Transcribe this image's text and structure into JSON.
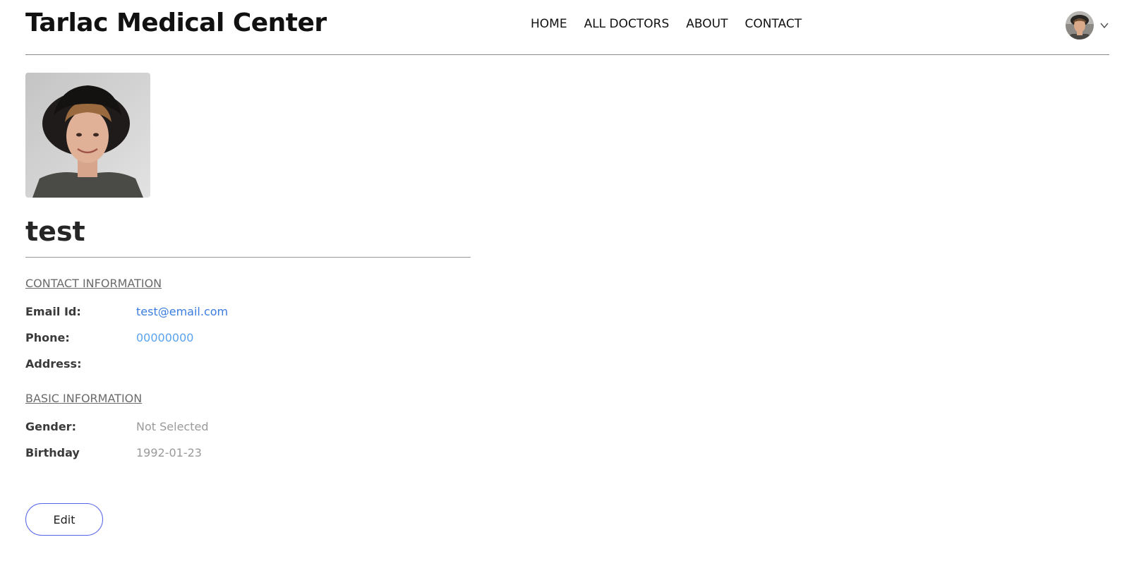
{
  "header": {
    "brand": "Tarlac Medical Center",
    "nav": [
      "HOME",
      "ALL DOCTORS",
      "ABOUT",
      "CONTACT"
    ],
    "user_menu_icon": "chevron-down-icon"
  },
  "profile": {
    "name": "test",
    "contact": {
      "title": "CONTACT INFORMATION",
      "email_label": "Email Id:",
      "email": "test@email.com",
      "phone_label": "Phone:",
      "phone": "00000000",
      "address_label": "Address:",
      "address": ""
    },
    "basic": {
      "title": "BASIC INFORMATION",
      "gender_label": "Gender:",
      "gender": "Not Selected",
      "birthday_label": "Birthday",
      "birthday": "1992-01-23"
    },
    "edit_label": "Edit"
  },
  "colors": {
    "link_blue": "#3b7de0",
    "phone_blue": "#5aa3f0",
    "button_border": "#5564e8"
  }
}
